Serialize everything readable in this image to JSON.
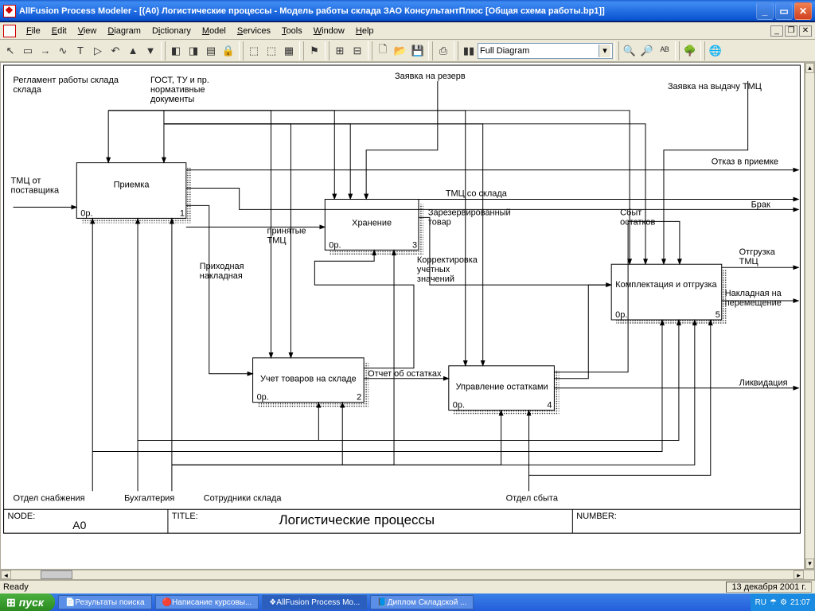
{
  "title": "AllFusion Process Modeler  - [(A0) Логистические процессы   - Модель работы склада ЗАО КонсультантПлюс  [Общая схема работы.bp1]]",
  "menus": [
    "File",
    "Edit",
    "View",
    "Diagram",
    "Dictionary",
    "Model",
    "Services",
    "Tools",
    "Window",
    "Help"
  ],
  "combo": "Full Diagram",
  "status_ready": "Ready",
  "status_date": "13 декабря 2001 г.",
  "footer": {
    "node": "NODE:",
    "a0": "A0",
    "title_lbl": "TITLE:",
    "title": "Логистические процессы",
    "number": "NUMBER:"
  },
  "boxes": {
    "b1": {
      "title": "Приемка",
      "node": "0р.",
      "num": "1"
    },
    "b2": {
      "title": "Учет товаров на складе",
      "node": "0р.",
      "num": "2"
    },
    "b3": {
      "title": "Хранение",
      "node": "0р.",
      "num": "3"
    },
    "b4": {
      "title": "Управление остатками",
      "node": "0р.",
      "num": "4"
    },
    "b5": {
      "title": "Комплектация и отгрузка",
      "node": "0р.",
      "num": "5"
    }
  },
  "labels": {
    "in1": "ТМЦ от поставщика",
    "top1": "Регламент работы склада",
    "top2": "ГОСТ, ТУ и пр. нормативные документы",
    "top3": "Заявка на резерв",
    "top4": "Заявка на выдачу ТМЦ",
    "o1": "Отказ в приемке",
    "o2": "ТМЦ со склада",
    "o3": "Брак",
    "o4": "Отгрузка ТМЦ",
    "o5": "Накладная на перемещение",
    "o6": "Ликвидация",
    "m1": "принятые ТМЦ",
    "m2": "Приходная накладная",
    "m3": "Зарезервированный товар",
    "m4": "Корректировка учетных значений",
    "m5": "Отчет об остатках",
    "m6": "Сбыт остатков",
    "bot1": "Отдел снабжения",
    "bot2": "Бухгалтерия",
    "bot3": "Сотрудники склада",
    "bot4": "Отдел сбыта"
  },
  "taskbar": {
    "start": "пуск",
    "items": [
      "Результаты поиска",
      "Написание курсовы...",
      "AllFusion Process Mo...",
      "Диплом Складской ..."
    ],
    "lang": "RU",
    "time": "21:07"
  }
}
